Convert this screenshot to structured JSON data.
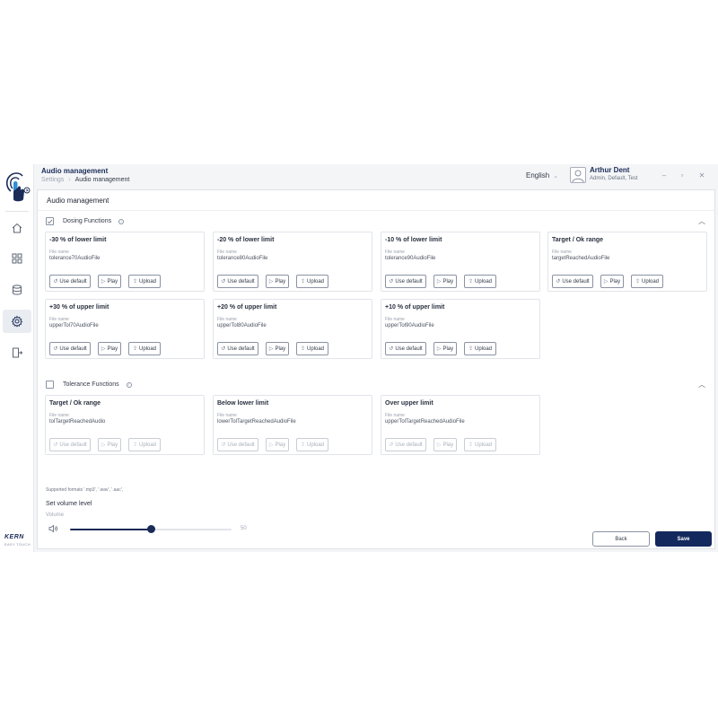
{
  "header": {
    "title": "Audio management",
    "breadcrumb": [
      "Settings",
      "Audio management"
    ],
    "language": "English",
    "user_name": "Arthur Dent",
    "user_roles": "Admin, Default, Test"
  },
  "sidebar": {
    "brand": "KERN",
    "brand_sub": "EASY TOUCH",
    "items": [
      {
        "icon": "home-icon"
      },
      {
        "icon": "grid-icon"
      },
      {
        "icon": "database-icon"
      },
      {
        "icon": "gear-icon",
        "active": true
      },
      {
        "icon": "logout-icon"
      }
    ]
  },
  "main": {
    "title": "Audio management",
    "file_name_label": "File name",
    "buttons": {
      "use_default": "Use default",
      "play": "Play",
      "upload": "Upload"
    },
    "dosing": {
      "label": "Dosing Functions",
      "checked": true,
      "cards": [
        {
          "title": "-30 % of lower limit",
          "file": "tolerance70AudioFile"
        },
        {
          "title": "-20 % of lower limit",
          "file": "tolerance80AudioFile"
        },
        {
          "title": "-10 % of lower limit",
          "file": "tolerance90AudioFile"
        },
        {
          "title": "Target / Ok range",
          "file": "targetReachedAudioFile"
        },
        {
          "title": "+30 % of upper limit",
          "file": "upperTol70AudioFile"
        },
        {
          "title": "+20 % of upper limit",
          "file": "upperTol80AudioFile"
        },
        {
          "title": "+10 % of upper limit",
          "file": "upperTol90AudioFile"
        }
      ]
    },
    "tolerance": {
      "label": "Tolerance Functions",
      "checked": false,
      "cards": [
        {
          "title": "Target / Ok range",
          "file": "tolTargetReachedAudio"
        },
        {
          "title": "Below lower limit",
          "file": "lowerTolTargetReachedAudioFile"
        },
        {
          "title": "Over upper limit",
          "file": "upperTolTargetReachedAudioFile"
        }
      ]
    },
    "supported_formats": "Supported formats '.mp3', '.wav', '.aac',",
    "volume": {
      "title": "Set volume level",
      "label": "Volume",
      "value": 50,
      "max": 100
    },
    "back_label": "Back",
    "save_label": "Save"
  },
  "colors": {
    "accent": "#13285c",
    "border": "#e1e4e9"
  }
}
